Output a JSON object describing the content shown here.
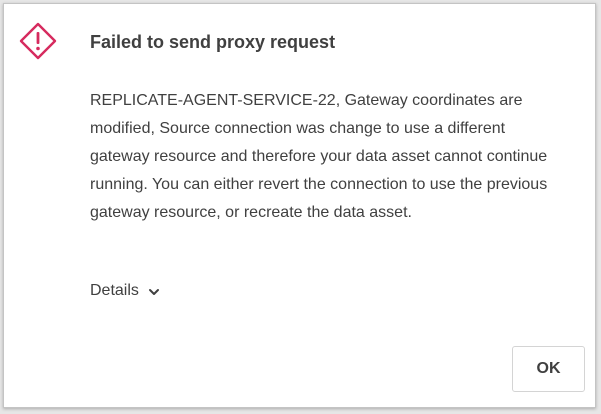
{
  "dialog": {
    "title": "Failed to send proxy request",
    "message": "REPLICATE-AGENT-SERVICE-22, Gateway coordinates are modified, Source connection was change to use a different gateway resource and therefore your data asset cannot continue running. You can either revert the connection to use the previous gateway resource, or recreate the data asset.",
    "details_label": "Details",
    "ok_label": "OK",
    "icon": "warning-diamond-icon",
    "colors": {
      "icon": "#d62a5e",
      "text": "#404040",
      "button_border": "#d4d4d4"
    }
  }
}
